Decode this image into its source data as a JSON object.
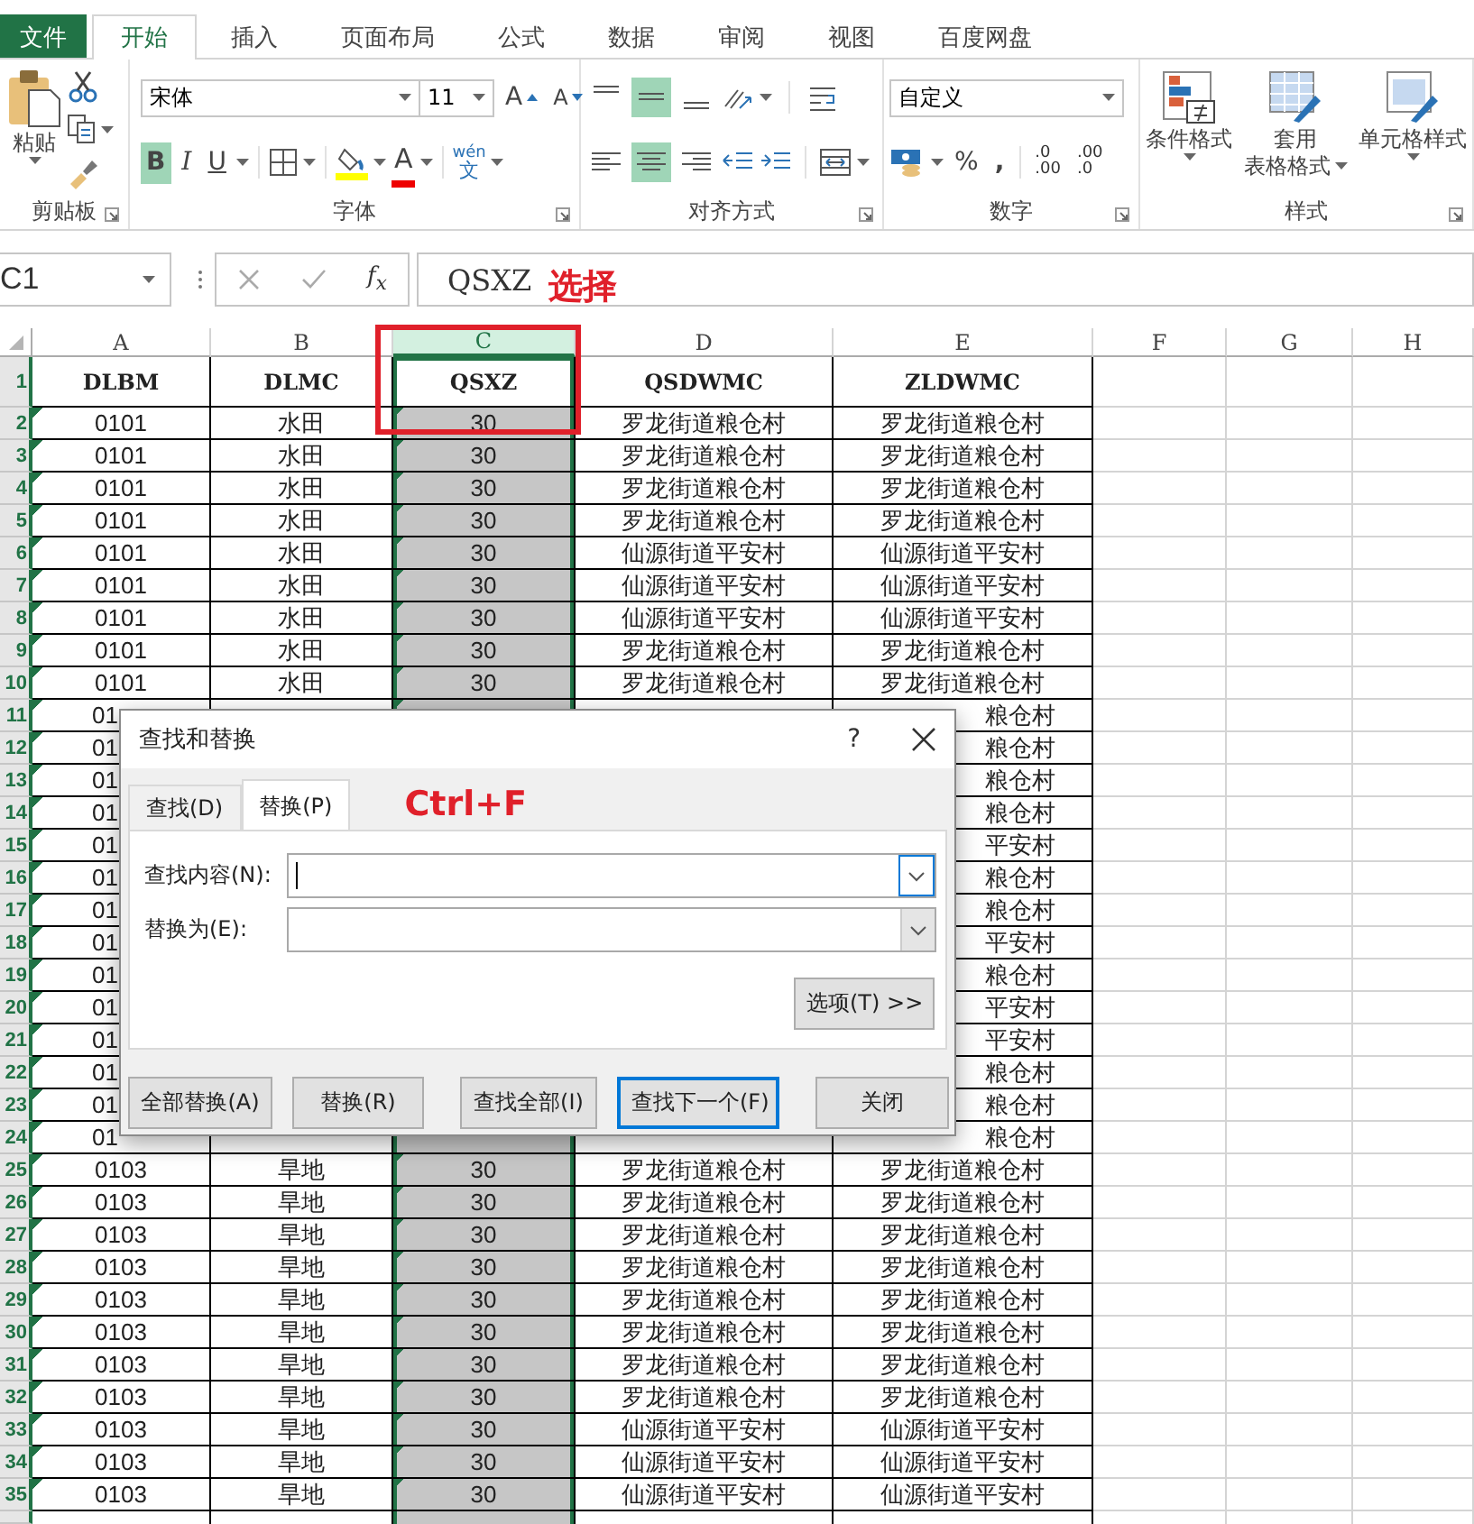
{
  "ribbon_tabs": [
    {
      "label": "文件",
      "kind": "file",
      "selected": false
    },
    {
      "label": "开始",
      "kind": "tab",
      "selected": true
    },
    {
      "label": "插入",
      "kind": "tab",
      "selected": false
    },
    {
      "label": "页面布局",
      "kind": "tab",
      "selected": false
    },
    {
      "label": "公式",
      "kind": "tab",
      "selected": false
    },
    {
      "label": "数据",
      "kind": "tab",
      "selected": false
    },
    {
      "label": "审阅",
      "kind": "tab",
      "selected": false
    },
    {
      "label": "视图",
      "kind": "tab",
      "selected": false
    },
    {
      "label": "百度网盘",
      "kind": "tab",
      "selected": false
    }
  ],
  "ribbon": {
    "clipboard": {
      "label": "剪贴板",
      "paste": "粘贴"
    },
    "font": {
      "label": "字体",
      "font_name": "宋体",
      "font_size": "11",
      "grow": "A",
      "shrink": "A",
      "styles": [
        {
          "label": "B",
          "kind": "bold",
          "on": true
        },
        {
          "label": "I",
          "kind": "italic",
          "on": false
        },
        {
          "label": "U",
          "kind": "underline",
          "on": false
        }
      ],
      "font_color": "A",
      "phonetic_top": "wén",
      "phonetic_bottom": "文"
    },
    "alignment": {
      "label": "对齐方式",
      "vertical": [
        {
          "kind": "top",
          "on": false
        },
        {
          "kind": "middle",
          "on": true
        },
        {
          "kind": "bottom",
          "on": false
        }
      ],
      "horizontal": [
        {
          "kind": "left",
          "on": false
        },
        {
          "kind": "center",
          "on": true
        },
        {
          "kind": "right",
          "on": false
        }
      ]
    },
    "number": {
      "label": "数字",
      "format": "自定义",
      "percent": "%",
      "comma": ",",
      "increase_decimal": {
        "top": ".0",
        "bottom": ".00"
      },
      "decrease_decimal": {
        "top": ".00",
        "bottom": ".0"
      }
    },
    "styles": {
      "label": "样式",
      "buttons": [
        {
          "kind": "conditional",
          "lines": [
            "条件格式"
          ]
        },
        {
          "kind": "table",
          "lines": [
            "套用",
            "表格格式"
          ]
        },
        {
          "kind": "cell",
          "lines": [
            "单元格样式"
          ]
        }
      ]
    }
  },
  "formula_bar": {
    "name_box": "C1",
    "function_label": "f$_{x}$",
    "formula": "QSXZ"
  },
  "sheet": {
    "columns": [
      {
        "letter": "A",
        "selected": false
      },
      {
        "letter": "B",
        "selected": false
      },
      {
        "letter": "C",
        "selected": true
      },
      {
        "letter": "D",
        "selected": false
      },
      {
        "letter": "E",
        "selected": false
      },
      {
        "letter": "F",
        "selected": false
      },
      {
        "letter": "G",
        "selected": false
      },
      {
        "letter": "H",
        "selected": false
      }
    ],
    "header_row": {
      "number": "1",
      "cells": [
        "DLBM",
        "DLMC",
        "QSXZ",
        "QSDWMC",
        "ZLDWMC"
      ]
    },
    "rows": [
      {
        "number": "2",
        "kind": "full",
        "flag": true,
        "cells": [
          "0101",
          "水田",
          "30",
          "罗龙街道粮仓村",
          "罗龙街道粮仓村"
        ]
      },
      {
        "number": "3",
        "kind": "full",
        "flag": true,
        "cells": [
          "0101",
          "水田",
          "30",
          "罗龙街道粮仓村",
          "罗龙街道粮仓村"
        ]
      },
      {
        "number": "4",
        "kind": "full",
        "flag": true,
        "cells": [
          "0101",
          "水田",
          "30",
          "罗龙街道粮仓村",
          "罗龙街道粮仓村"
        ]
      },
      {
        "number": "5",
        "kind": "full",
        "flag": true,
        "cells": [
          "0101",
          "水田",
          "30",
          "罗龙街道粮仓村",
          "罗龙街道粮仓村"
        ]
      },
      {
        "number": "6",
        "kind": "full",
        "flag": true,
        "cells": [
          "0101",
          "水田",
          "30",
          "仙源街道平安村",
          "仙源街道平安村"
        ]
      },
      {
        "number": "7",
        "kind": "full",
        "flag": true,
        "cells": [
          "0101",
          "水田",
          "30",
          "仙源街道平安村",
          "仙源街道平安村"
        ]
      },
      {
        "number": "8",
        "kind": "full",
        "flag": true,
        "cells": [
          "0101",
          "水田",
          "30",
          "仙源街道平安村",
          "仙源街道平安村"
        ]
      },
      {
        "number": "9",
        "kind": "full",
        "flag": true,
        "cells": [
          "0101",
          "水田",
          "30",
          "罗龙街道粮仓村",
          "罗龙街道粮仓村"
        ]
      },
      {
        "number": "10",
        "kind": "full",
        "flag": true,
        "cells": [
          "0101",
          "水田",
          "30",
          "罗龙街道粮仓村",
          "罗龙街道粮仓村"
        ]
      },
      {
        "number": "11",
        "kind": "covered",
        "flag": true,
        "cells": [
          "01",
          "粮仓村"
        ]
      },
      {
        "number": "12",
        "kind": "covered",
        "flag": true,
        "cells": [
          "01",
          "粮仓村"
        ]
      },
      {
        "number": "13",
        "kind": "covered",
        "flag": true,
        "cells": [
          "01",
          "粮仓村"
        ]
      },
      {
        "number": "14",
        "kind": "covered",
        "flag": true,
        "cells": [
          "01",
          "粮仓村"
        ]
      },
      {
        "number": "15",
        "kind": "covered",
        "flag": true,
        "cells": [
          "01",
          "平安村"
        ]
      },
      {
        "number": "16",
        "kind": "covered",
        "flag": true,
        "cells": [
          "01",
          "粮仓村"
        ]
      },
      {
        "number": "17",
        "kind": "covered",
        "flag": true,
        "cells": [
          "01",
          "粮仓村"
        ]
      },
      {
        "number": "18",
        "kind": "covered",
        "flag": true,
        "cells": [
          "01",
          "平安村"
        ]
      },
      {
        "number": "19",
        "kind": "covered",
        "flag": true,
        "cells": [
          "01",
          "粮仓村"
        ]
      },
      {
        "number": "20",
        "kind": "covered",
        "flag": true,
        "cells": [
          "01",
          "平安村"
        ]
      },
      {
        "number": "21",
        "kind": "covered",
        "flag": true,
        "cells": [
          "01",
          "平安村"
        ]
      },
      {
        "number": "22",
        "kind": "covered",
        "flag": true,
        "cells": [
          "01",
          "粮仓村"
        ]
      },
      {
        "number": "23",
        "kind": "covered",
        "flag": true,
        "cells": [
          "01",
          "粮仓村"
        ]
      },
      {
        "number": "24",
        "kind": "covered",
        "flag": true,
        "cells": [
          "01",
          "粮仓村"
        ]
      },
      {
        "number": "25",
        "kind": "full",
        "flag": true,
        "cells": [
          "0103",
          "旱地",
          "30",
          "罗龙街道粮仓村",
          "罗龙街道粮仓村"
        ]
      },
      {
        "number": "26",
        "kind": "full",
        "flag": true,
        "cells": [
          "0103",
          "旱地",
          "30",
          "罗龙街道粮仓村",
          "罗龙街道粮仓村"
        ]
      },
      {
        "number": "27",
        "kind": "full",
        "flag": true,
        "cells": [
          "0103",
          "旱地",
          "30",
          "罗龙街道粮仓村",
          "罗龙街道粮仓村"
        ]
      },
      {
        "number": "28",
        "kind": "full",
        "flag": true,
        "cells": [
          "0103",
          "旱地",
          "30",
          "罗龙街道粮仓村",
          "罗龙街道粮仓村"
        ]
      },
      {
        "number": "29",
        "kind": "full",
        "flag": true,
        "cells": [
          "0103",
          "旱地",
          "30",
          "罗龙街道粮仓村",
          "罗龙街道粮仓村"
        ]
      },
      {
        "number": "30",
        "kind": "full",
        "flag": true,
        "cells": [
          "0103",
          "旱地",
          "30",
          "罗龙街道粮仓村",
          "罗龙街道粮仓村"
        ]
      },
      {
        "number": "31",
        "kind": "full",
        "flag": true,
        "cells": [
          "0103",
          "旱地",
          "30",
          "罗龙街道粮仓村",
          "罗龙街道粮仓村"
        ]
      },
      {
        "number": "32",
        "kind": "full",
        "flag": true,
        "cells": [
          "0103",
          "旱地",
          "30",
          "罗龙街道粮仓村",
          "罗龙街道粮仓村"
        ]
      },
      {
        "number": "33",
        "kind": "full",
        "flag": true,
        "cells": [
          "0103",
          "旱地",
          "30",
          "仙源街道平安村",
          "仙源街道平安村"
        ]
      },
      {
        "number": "34",
        "kind": "full",
        "flag": true,
        "cells": [
          "0103",
          "旱地",
          "30",
          "仙源街道平安村",
          "仙源街道平安村"
        ]
      },
      {
        "number": "35",
        "kind": "full",
        "flag": true,
        "cells": [
          "0103",
          "旱地",
          "30",
          "仙源街道平安村",
          "仙源街道平安村"
        ]
      }
    ]
  },
  "notes": {
    "select": "选择",
    "shortcut": "Ctrl+F"
  },
  "dialog": {
    "title": "查找和替换",
    "help": "?",
    "tabs": [
      {
        "label": "查找(D)",
        "selected": false
      },
      {
        "label": "替换(P)",
        "selected": true
      }
    ],
    "fields": [
      {
        "label": "查找内容(N):",
        "focused": true
      },
      {
        "label": "替换为(E):",
        "focused": false
      }
    ],
    "options_button": "选项(T) >>",
    "buttons": [
      {
        "label": "全部替换(A)",
        "default": false
      },
      {
        "label": "替换(R)",
        "default": false
      },
      {
        "label": "查找全部(I)",
        "default": false
      },
      {
        "label": "查找下一个(F)",
        "default": true
      },
      {
        "label": "关闭",
        "default": false
      }
    ]
  }
}
